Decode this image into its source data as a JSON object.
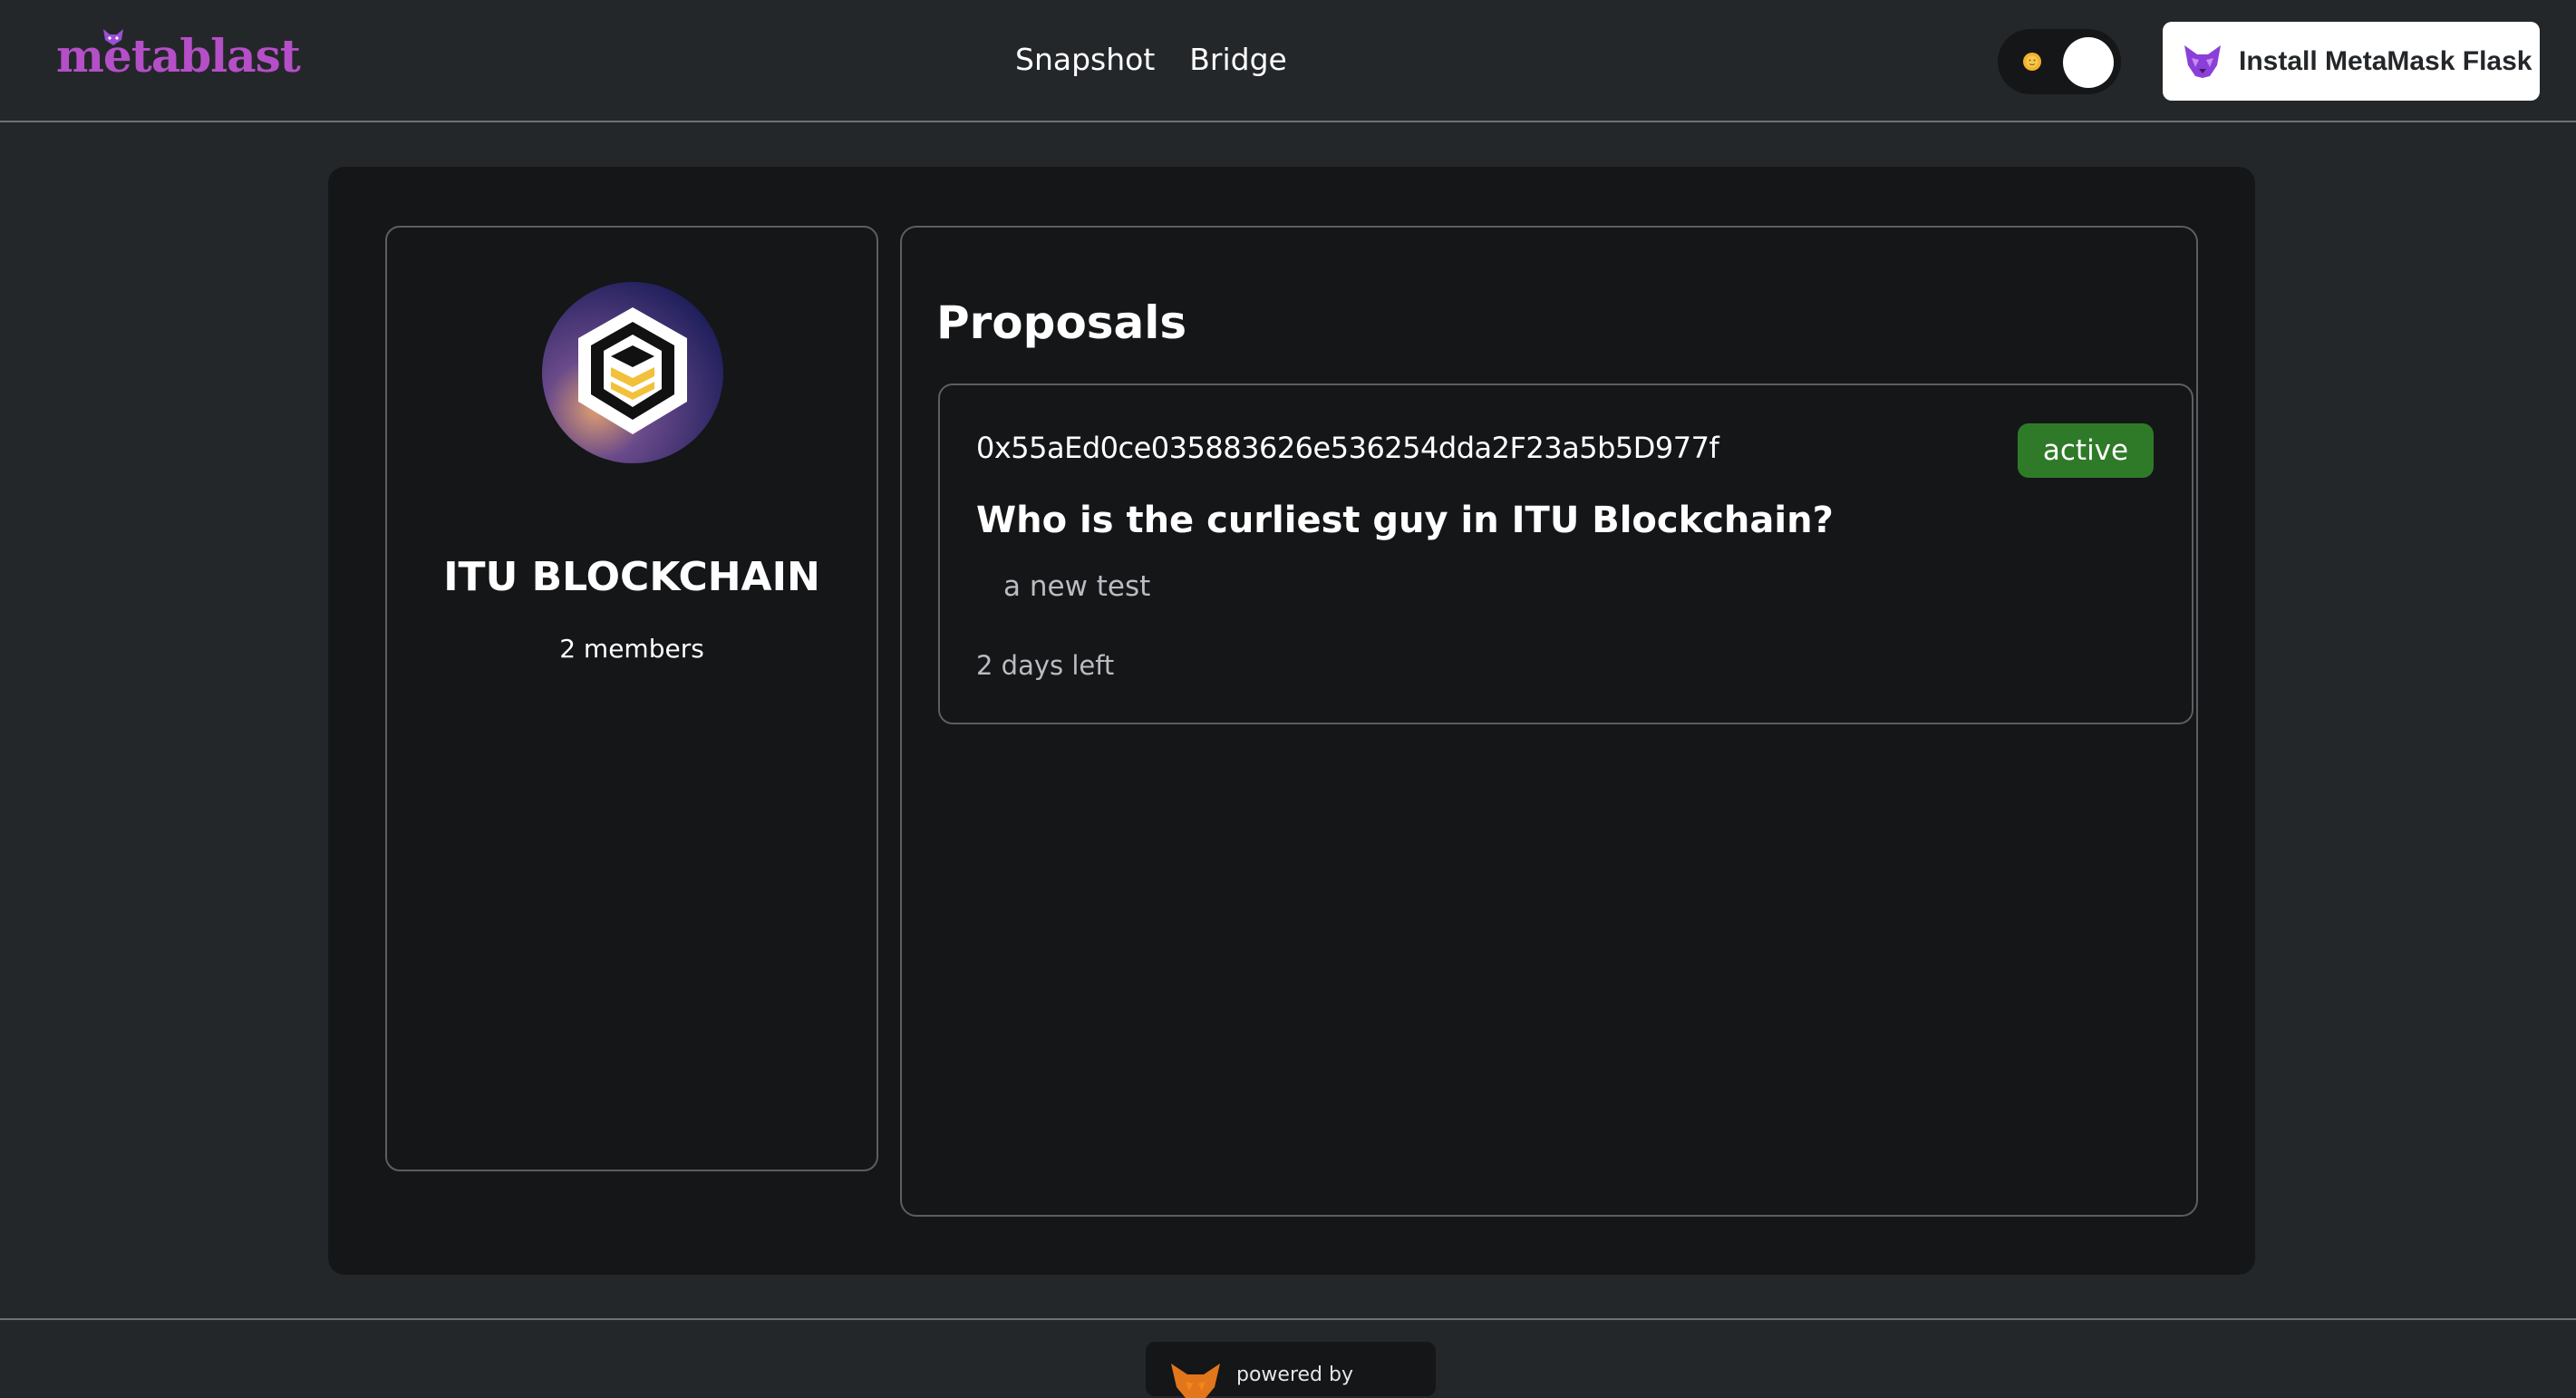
{
  "header": {
    "logo_text": "metablast",
    "nav": [
      "Snapshot",
      "Bridge"
    ],
    "install_button": "Install MetaMask Flask"
  },
  "dao": {
    "name": "ITU BLOCKCHAIN",
    "members": "2 members"
  },
  "proposals": {
    "title": "Proposals",
    "items": [
      {
        "author": "0x55aEd0ce035883626e536254dda2F23a5b5D977f",
        "status": "active",
        "title": "Who is the curliest guy in ITU Blockchain?",
        "body": "a new test",
        "time_left": "2 days left"
      }
    ]
  },
  "footer": {
    "powered_by": "powered by"
  },
  "colors": {
    "accent": "#b54fc7",
    "status_active": "#2f7a28",
    "background": "#24272a",
    "panel": "#141618"
  },
  "icons": [
    "metamask-fox-icon",
    "sun-icon",
    "itu-blockchain-logo"
  ]
}
